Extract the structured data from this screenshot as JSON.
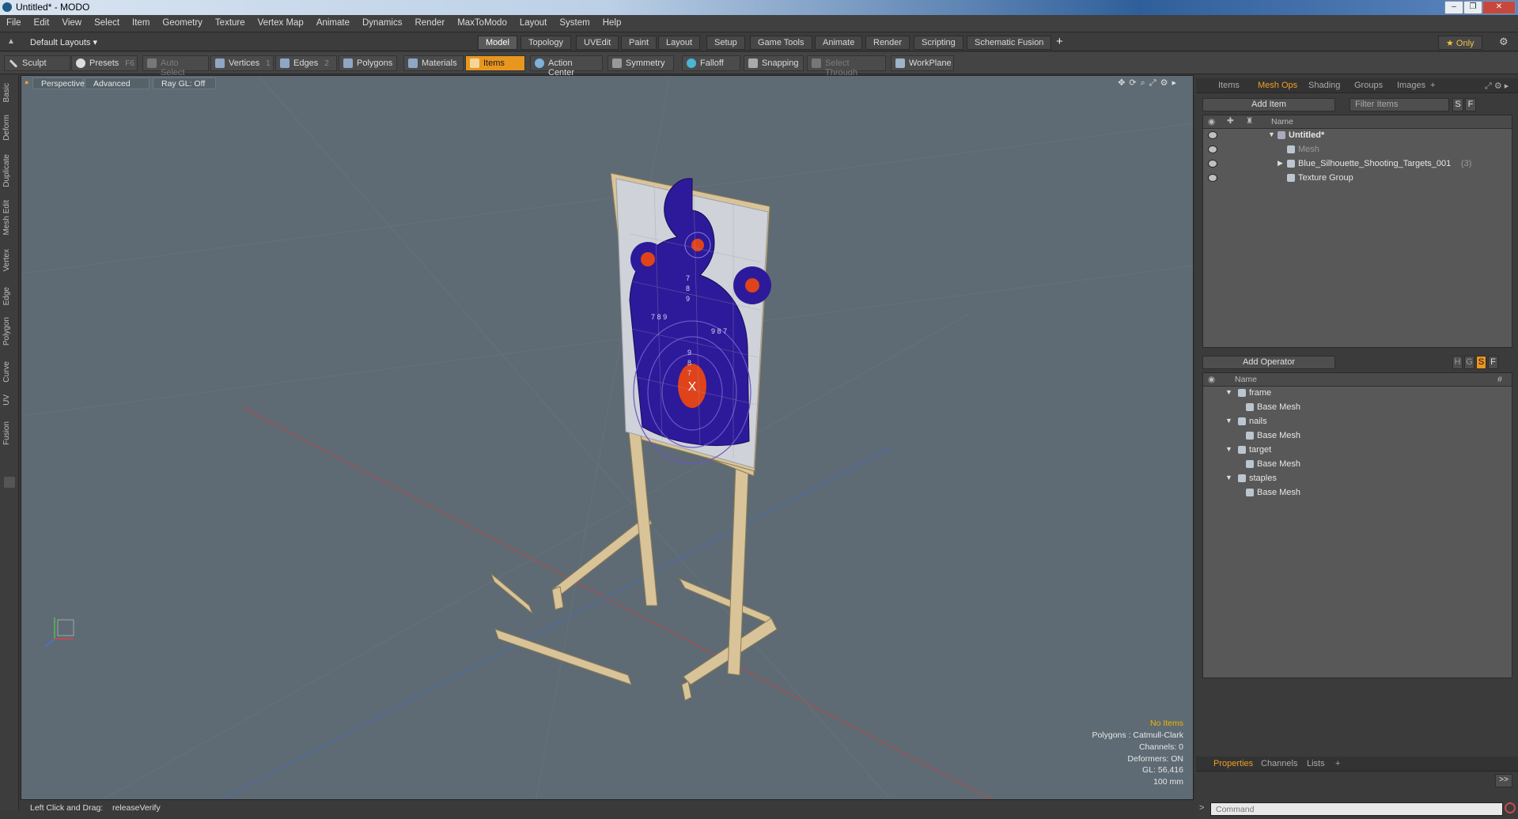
{
  "window": {
    "title": "Untitled* - MODO",
    "buttons": [
      "–",
      "❐",
      "✕"
    ]
  },
  "menu": [
    "File",
    "Edit",
    "View",
    "Select",
    "Item",
    "Geometry",
    "Texture",
    "Vertex Map",
    "Animate",
    "Dynamics",
    "Render",
    "MaxToModo",
    "Layout",
    "System",
    "Help"
  ],
  "layout_selector": "Default Layouts ▾",
  "mode_tabs": [
    "Model",
    "Topology",
    "UVEdit",
    "Paint",
    "Layout",
    "Setup",
    "Game Tools",
    "Animate",
    "Render",
    "Scripting",
    "Schematic Fusion"
  ],
  "active_mode_tab": "Model",
  "plus_label": "+",
  "only_label": "★  Only",
  "toolbar": {
    "sculpt": "Sculpt",
    "presets": "Presets",
    "presets_key": "F6",
    "auto_select": "Auto Select",
    "vertices": "Vertices",
    "vertices_key": "1",
    "edges": "Edges",
    "edges_key": "2",
    "polygons": "Polygons",
    "materials": "Materials",
    "items": "Items",
    "action_center": "Action Center",
    "symmetry": "Symmetry",
    "falloff": "Falloff",
    "snapping": "Snapping",
    "select_through": "Select Through",
    "workplane": "WorkPlane"
  },
  "left_tabs": [
    "Basic",
    "Deform",
    "Duplicate",
    "Mesh Edit",
    "Vertex",
    "Edge",
    "Polygon",
    "Curve",
    "UV",
    "Fusion"
  ],
  "viewport": {
    "view": "Perspective",
    "style": "Advanced",
    "raygl": "Ray GL: Off",
    "info": {
      "selection": "No Items",
      "polygons": "Polygons : Catmull-Clark",
      "channels": "Channels: 0",
      "deformers": "Deformers: ON",
      "gl": "GL: 56,416",
      "scale": "100 mm"
    },
    "target_numbers": [
      "7",
      "8",
      "9",
      "7",
      "8",
      "9",
      "9",
      "8",
      "7",
      "9",
      "8",
      "7"
    ]
  },
  "status": {
    "hint": "Left Click and Drag:",
    "action": "releaseVerify"
  },
  "item_panel": {
    "tabs": [
      "Items",
      "Mesh Ops",
      "Shading",
      "Groups",
      "Images",
      "+"
    ],
    "active_tab": "Mesh Ops",
    "add_item": "Add Item",
    "filter": "Filter Items",
    "s_btn": "S",
    "f_btn": "F",
    "name_header": "Name",
    "rows": [
      {
        "label": "Untitled*",
        "indent": 0,
        "expand": "▼"
      },
      {
        "label": "Mesh",
        "indent": 1,
        "dim": true
      },
      {
        "label": "Blue_Silhouette_Shooting_Targets_001",
        "count": "(3)",
        "indent": 1,
        "expand": "▶"
      },
      {
        "label": "Texture Group",
        "indent": 1
      }
    ]
  },
  "operator_panel": {
    "add_operator": "Add Operator",
    "btns": [
      "H",
      "G",
      "S",
      "F"
    ],
    "name_header": "Name",
    "hash_header": "#",
    "groups": [
      {
        "name": "frame",
        "child": "Base Mesh"
      },
      {
        "name": "nails",
        "child": "Base Mesh"
      },
      {
        "name": "target",
        "child": "Base Mesh"
      },
      {
        "name": "staples",
        "child": "Base Mesh"
      }
    ]
  },
  "bottom_panel": {
    "tabs": [
      "Properties",
      "Channels",
      "Lists",
      "+"
    ],
    "active_tab": "Properties",
    "expand_btn": ">>",
    "command_placeholder": "Command"
  }
}
